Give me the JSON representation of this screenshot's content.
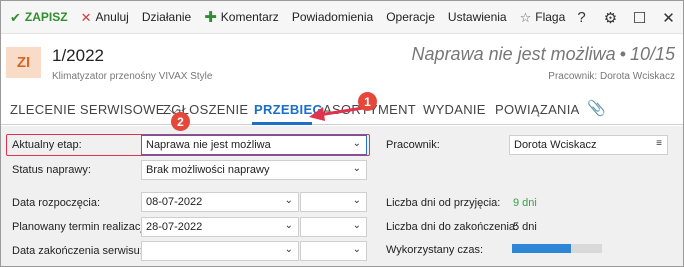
{
  "toolbar": {
    "save": "ZAPISZ",
    "cancel": "Anuluj",
    "action": "Działanie",
    "comment": "Komentarz",
    "notifications": "Powiadomienia",
    "operations": "Operacje",
    "settings": "Ustawienia",
    "flag": "Flaga",
    "right_icons": [
      "help-icon",
      "gear-icon",
      "maximize-icon",
      "close-icon"
    ],
    "help_glyph": "?",
    "gear_glyph": "⚙",
    "max_glyph": "☐",
    "close_glyph": "✕"
  },
  "header": {
    "badge": "ZI",
    "doc_number": "1/2022",
    "doc_subtitle": "Klimatyzator przenośny VIVAX Style",
    "status": "Naprawa nie jest możliwa",
    "separator": "•",
    "step": "10/15",
    "worker_line": "Pracownik: Dorota Wciskacz"
  },
  "tabs": [
    {
      "label": "ZLECENIE SERWISOWE ⌵",
      "active": false
    },
    {
      "label": "ZGŁOSZENIE",
      "active": false
    },
    {
      "label": "PRZEBIEG",
      "active": true
    },
    {
      "label": "ASORTYMENT",
      "active": false
    },
    {
      "label": "WYDANIE",
      "active": false
    },
    {
      "label": "POWIĄZANIA",
      "active": false
    }
  ],
  "form": {
    "current_stage_label": "Aktualny etap:",
    "current_stage_value": "Naprawa nie jest możliwa",
    "repair_status_label": "Status naprawy:",
    "repair_status_value": "Brak możliwości naprawy",
    "start_date_label": "Data rozpoczęcia:",
    "start_date_value": "08-07-2022",
    "planned_date_label": "Planowany termin realizacji:",
    "planned_date_value": "28-07-2022",
    "end_date_label": "Data zakończenia serwisu:",
    "end_date_value": "",
    "worker_label": "Pracownik:",
    "worker_value": "Dorota Wciskacz",
    "days_since_label": "Liczba dni od przyjęcia:",
    "days_since_value": "9 dni",
    "days_to_end_label": "Liczba dni do zakończenia:",
    "days_to_end_value": "5 dni",
    "time_used_label": "Wykorzystany czas:",
    "time_used_fraction": 0.65
  },
  "callouts": {
    "one": "1",
    "two": "2"
  },
  "colors": {
    "accent": "#1c6ec6",
    "save_green": "#2f8f2f",
    "badge_bg": "#f9dcc7",
    "badge_text": "#d8662a",
    "annotation_red": "#e0334d",
    "days_green": "#35a04a"
  }
}
